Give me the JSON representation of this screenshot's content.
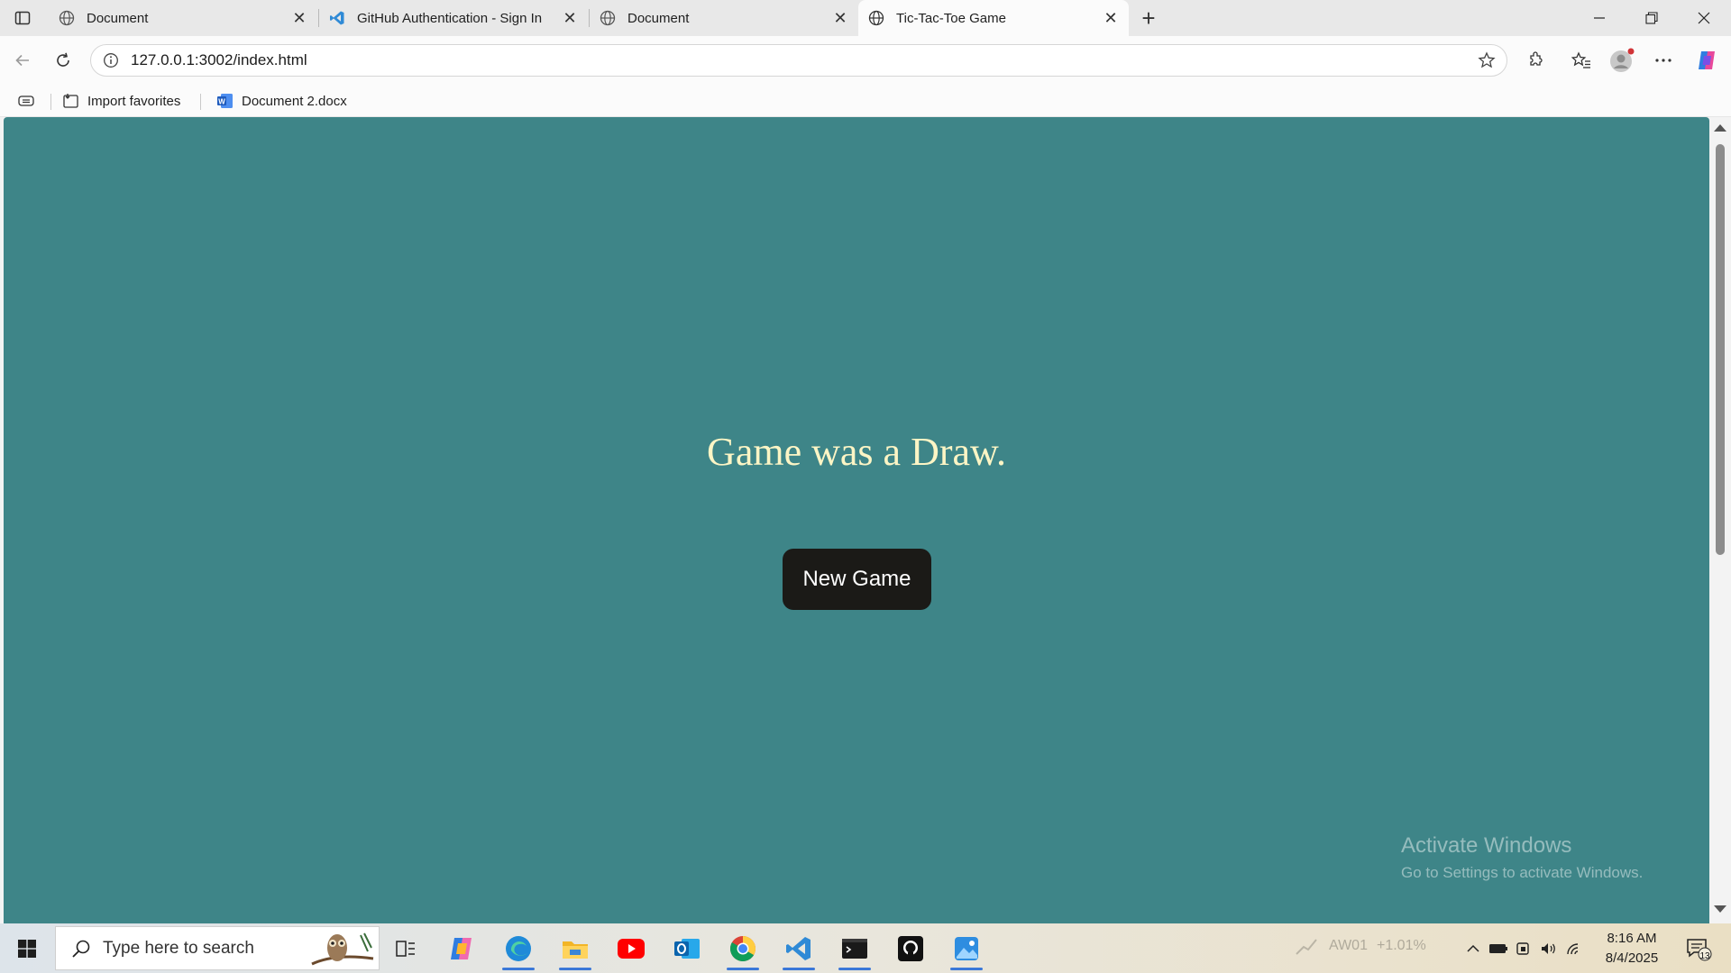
{
  "browser": {
    "tabs": [
      {
        "title": "Document",
        "icon": "globe-icon",
        "active": false
      },
      {
        "title": "GitHub Authentication - Sign In",
        "icon": "vscode-icon",
        "active": false
      },
      {
        "title": "Document",
        "icon": "globe-icon",
        "active": false
      },
      {
        "title": "Tic-Tac-Toe Game",
        "icon": "globe-icon",
        "active": true
      }
    ],
    "close_glyph": "✕",
    "new_tab_glyph": "+",
    "url": "127.0.0.1:3002/index.html",
    "favorites": [
      {
        "label": "Import favorites",
        "icon": "import-favorites-icon"
      },
      {
        "label": "Document 2.docx",
        "icon": "word-icon"
      }
    ]
  },
  "page": {
    "background": "#3e8588",
    "status_text": "Game was a Draw.",
    "new_game_label": "New Game",
    "watermark_title": "Activate Windows",
    "watermark_subtitle": "Go to Settings to activate Windows."
  },
  "taskbar": {
    "search_placeholder": "Type here to search",
    "apps": [
      "copilot-icon",
      "edge-icon",
      "file-explorer-icon",
      "youtube-icon",
      "outlook-icon",
      "chrome-icon",
      "vscode-icon",
      "terminal-icon",
      "github-icon",
      "photos-icon"
    ],
    "stock_label": "AW01",
    "stock_change": "+1.01%",
    "time": "8:16 AM",
    "date": "8/4/2025",
    "notification_count": "13"
  }
}
